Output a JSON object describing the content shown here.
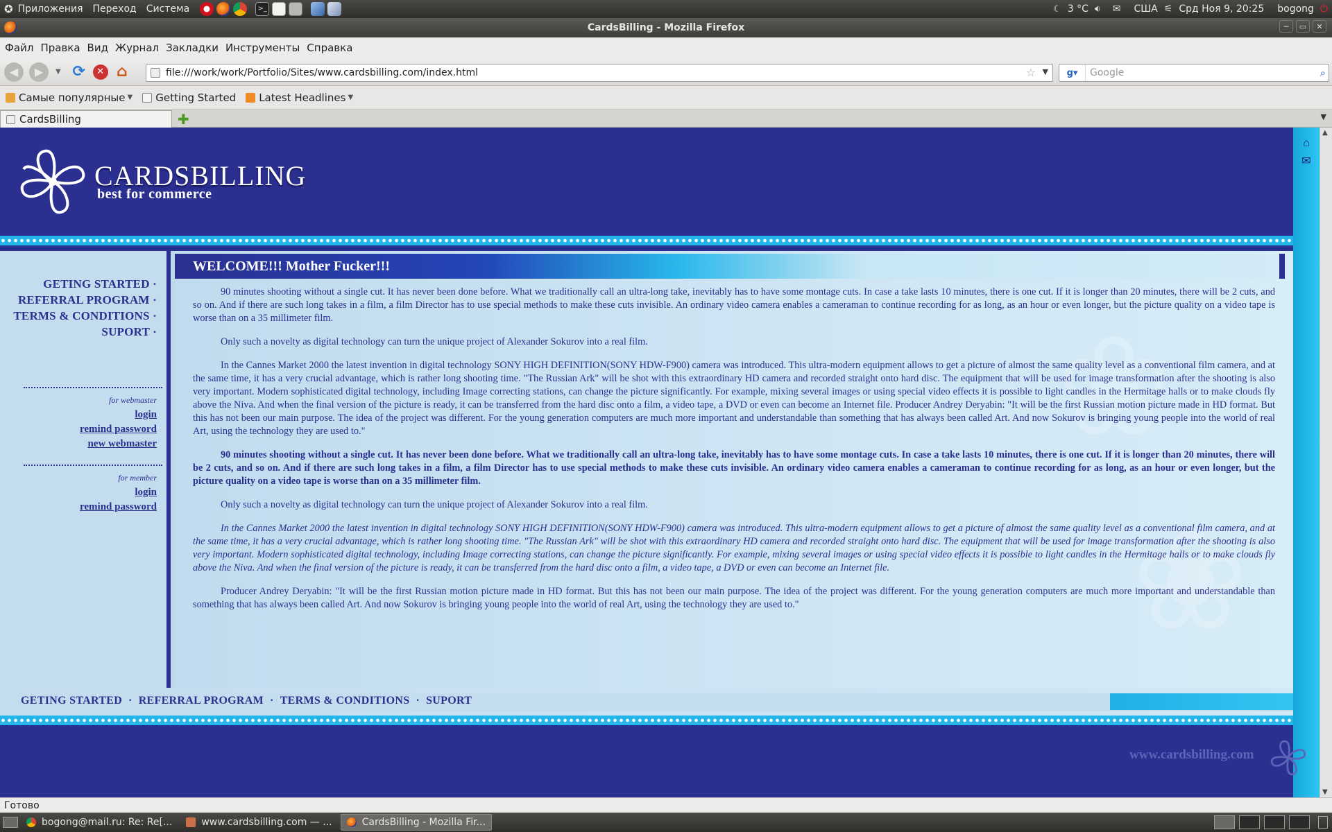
{
  "system_panel": {
    "menu_apps": "Приложения",
    "menu_go": "Переход",
    "menu_system": "Система",
    "weather": "3 °C",
    "keyboard_layout": "США",
    "datetime": "Срд Ноя  9, 20:25",
    "user": "bogong"
  },
  "window": {
    "title": "CardsBilling - Mozilla Firefox"
  },
  "menubar": {
    "items": [
      "Файл",
      "Правка",
      "Вид",
      "Журнал",
      "Закладки",
      "Инструменты",
      "Справка"
    ]
  },
  "navbar": {
    "url": "file:///work/work/Portfolio/Sites/www.cardsbilling.com/index.html",
    "search_placeholder": "Google"
  },
  "bookmarks": {
    "items": [
      "Самые популярные",
      "Getting Started",
      "Latest Headlines"
    ]
  },
  "tabs": {
    "active": "CardsBilling"
  },
  "page": {
    "logo_title": "CARDSBILLING",
    "logo_subtitle": "best for commerce",
    "welcome": "WELCOME!!! Mother Fucker!!!",
    "nav": [
      "GETING STARTED ·",
      "REFERRAL PROGRAM ·",
      "TERMS & CONDITIONS ·",
      "SUPORT ·"
    ],
    "webmaster": {
      "label": "for webmaster",
      "links": [
        "login",
        "remind password",
        "new webmaster"
      ]
    },
    "member": {
      "label": "for member",
      "links": [
        "login",
        "remind password"
      ]
    },
    "paragraphs": [
      " 90 minutes shooting without a single cut. It has never been done before. What we traditionally call an ultra-long take, inevitably has to have some montage cuts. In case a take lasts 10 minutes, there is one cut. If it is longer than 20 minutes, there will be 2 cuts, and so on. And if there are such long takes in a film, a film Director has to use special methods to make these cuts invisible. An ordinary video camera enables a cameraman to continue recording for as long, as an hour or even longer, but the picture quality on a video tape is worse than on a 35 millimeter film.",
      "Only such a novelty as digital technology can turn the unique project of Alexander Sokurov into a real film.",
      "In the Cannes Market 2000 the latest invention in digital technology SONY HIGH DEFINITION(SONY HDW-F900) camera was introduced. This ultra-modern equipment allows to get a picture of almost the same quality level as a conventional film camera, and at the same time, it has a very crucial advantage, which is rather long shooting time. \"The Russian Ark\" will be shot with this extraordinary HD camera and recorded straight onto hard disc. The equipment that will be used for image transformation after the shooting is also very important. Modern sophisticated digital technology, including Image correcting stations, can change the picture significantly. For example, mixing several images or using special video effects it is possible to light candles in the Hermitage halls or to make clouds fly above the Niva. And when the final version of the picture is ready, it can be transferred from the hard disc onto a film, a video tape, a DVD or even can become an Internet file. Producer Andrey Deryabin: \"It will be the first Russian motion picture made in HD format. But this has not been our main purpose. The idea of the project was different. For the young generation computers are much more important and understandable than something that has always been called Art. And now Sokurov is bringing young people into the world of real Art, using the technology they are used to.\"",
      "90 minutes shooting without a single cut. It has never been done before. What we traditionally call an ultra-long take, inevitably has to have some montage cuts. In case a take lasts 10 minutes, there is one cut. If it is longer than 20 minutes, there will be 2 cuts, and so on. And if there are such long takes in a film, a film Director has to use special methods to make these cuts invisible. An ordinary video camera enables a cameraman to continue recording for as long, as an hour or even longer, but the picture quality on a video tape is worse than on a 35 millimeter film.",
      "Only such a novelty as digital technology can turn the unique project of Alexander Sokurov into a real film.",
      "In the Cannes Market 2000 the latest invention in digital technology SONY HIGH DEFINITION(SONY HDW-F900) camera was introduced. This ultra-modern equipment allows to get a picture of almost the same quality level as a conventional film camera, and at the same time, it has a very crucial advantage, which is rather long shooting time. \"The Russian Ark\" will be shot with this extraordinary HD camera and recorded straight onto hard disc. The equipment that will be used for image transformation after the shooting is also very important. Modern sophisticated digital technology, including Image correcting stations, can change the picture significantly. For example, mixing several images or using special video effects it is possible to light candles in the Hermitage halls or to make clouds fly above the Niva. And when the final version of the picture is ready, it can be transferred from the hard disc onto a film, a video tape, a DVD or even can become an Internet file.",
      "Producer Andrey Deryabin: \"It will be the first Russian motion picture made in HD format. But this has not been our main purpose. The idea of the project was different. For the young generation computers are much more important and understandable than something that has always been called Art. And now Sokurov is bringing young people into the world of real Art, using the technology they are used to.\""
    ],
    "footer_nav": [
      "GETING STARTED",
      "REFERRAL PROGRAM",
      "TERMS & CONDITIONS",
      "SUPORT"
    ],
    "footer_separator": "·",
    "site_url": "www.cardsbilling.com"
  },
  "status": {
    "text": "Готово"
  },
  "taskbar": {
    "items": [
      "bogong@mail.ru: Re: Re[...",
      "www.cardsbilling.com — ...",
      "CardsBilling - Mozilla Fir..."
    ]
  },
  "colors": {
    "page_navy": "#2b2f90",
    "cyan_accent": "#22b6ea",
    "content_bg": "#bcd9ec"
  },
  "icons": [
    "ubuntu-logo-icon",
    "opera-icon",
    "firefox-icon",
    "chrome-icon",
    "terminal-icon",
    "text-editor-icon",
    "calculator-icon",
    "virtualbox-icon",
    "weather-icon",
    "volume-icon",
    "mail-icon",
    "network-icon",
    "power-icon",
    "back-icon",
    "forward-icon",
    "reload-icon",
    "stop-icon",
    "home-icon",
    "bookmark-star-icon",
    "search-go-icon",
    "rss-icon",
    "new-tab-icon",
    "home-print-icon",
    "email-envelope-icon"
  ]
}
